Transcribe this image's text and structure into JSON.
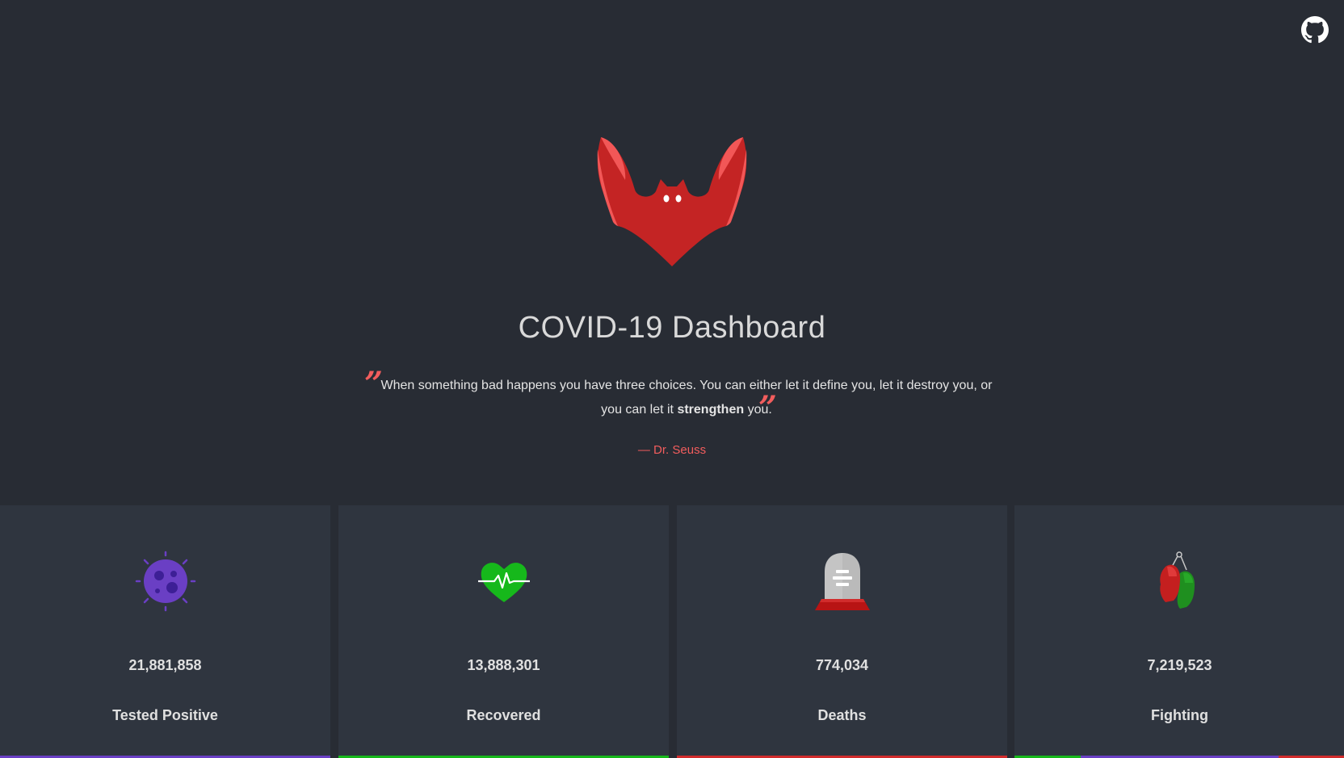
{
  "header": {
    "github_icon": "github-icon",
    "logo_icon": "bat-logo-icon",
    "title": "COVID-19 Dashboard"
  },
  "quote": {
    "text_before": "When something bad happens you have three choices. You can either let it define you, let it destroy you, or you can let it ",
    "emphasis": "strengthen",
    "text_after": " you.",
    "open_mark": "”",
    "close_mark": "”",
    "author": "— Dr. Seuss"
  },
  "colors": {
    "background": "#282c34",
    "card_background": "#2f353f",
    "accent": "#f25d5d",
    "positive": "#6a3fc4",
    "recovered": "#16b81b",
    "deaths": "#d12c2c",
    "fighting_green": "#2a9d2a",
    "fighting_red": "#d12c2c"
  },
  "stats": [
    {
      "label": "Tested Positive",
      "count": "21,881,858",
      "icon": "virus-icon"
    },
    {
      "label": "Recovered",
      "count": "13,888,301",
      "icon": "heartbeat-icon"
    },
    {
      "label": "Deaths",
      "count": "774,034",
      "icon": "tombstone-icon"
    },
    {
      "label": "Fighting",
      "count": "7,219,523",
      "icon": "boxing-gloves-icon"
    }
  ]
}
